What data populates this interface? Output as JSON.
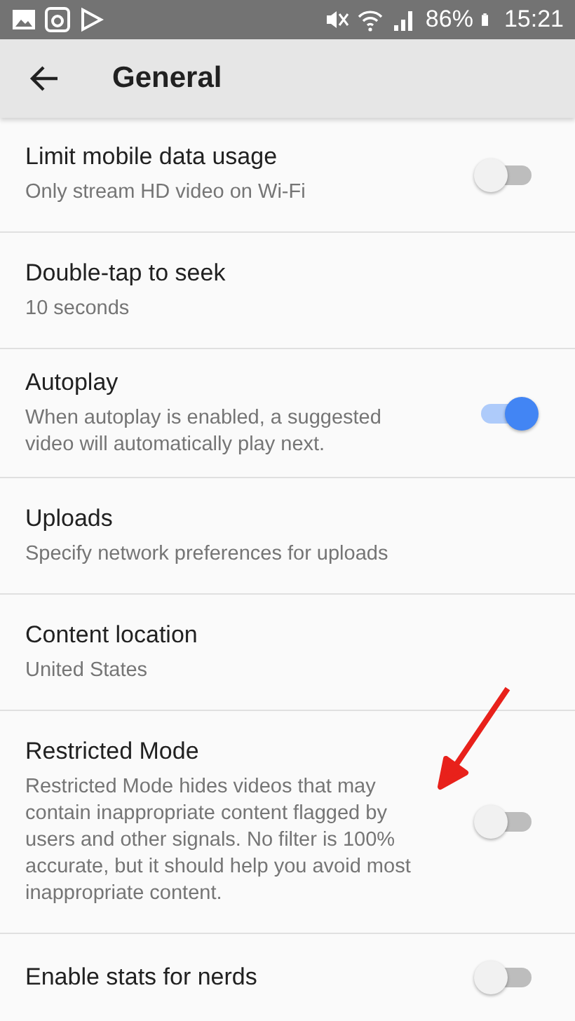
{
  "status_bar": {
    "battery": "86%",
    "time": "15:21"
  },
  "toolbar": {
    "title": "General"
  },
  "settings": [
    {
      "kind": "toggle",
      "title": "Limit mobile data usage",
      "subtitle": "Only stream HD video on Wi-Fi",
      "on": false
    },
    {
      "kind": "plain",
      "title": "Double-tap to seek",
      "subtitle": "10 seconds"
    },
    {
      "kind": "toggle",
      "title": "Autoplay",
      "subtitle": "When autoplay is enabled, a suggested video will automatically play next.",
      "on": true
    },
    {
      "kind": "plain",
      "title": "Uploads",
      "subtitle": "Specify network preferences for uploads"
    },
    {
      "kind": "plain",
      "title": "Content location",
      "subtitle": "United States"
    },
    {
      "kind": "toggle",
      "title": "Restricted Mode",
      "subtitle": "Restricted Mode hides videos that may contain inappropriate content flagged by users and other signals. No filter is 100% accurate, but it should help you avoid most inappropriate content.",
      "on": false,
      "annotated": true
    },
    {
      "kind": "toggle",
      "title": "Enable stats for nerds",
      "on": false
    }
  ]
}
